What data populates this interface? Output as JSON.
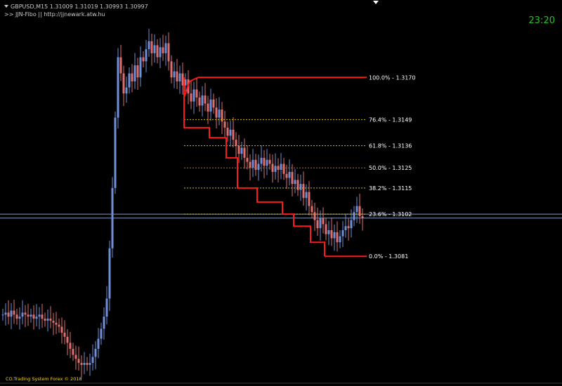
{
  "header": {
    "symbol_line": "GBPUSD,M15  1.31009 1.31019 1.30993 1.30997",
    "indicator_line": ">> JJN-Fibo || http://jjnewark.atw.hu"
  },
  "clock": "23:20",
  "copyright": "CO.Trading System Forex © 2018",
  "colors": {
    "background": "#000000",
    "bull_candle": "#6f8fd8",
    "bear_candle": "#e07070",
    "fib_frame": "#ff1a1a",
    "fib_level": "#d6c400",
    "fib_mid": "#c07000",
    "price_line": "#7d9cc4",
    "clock": "#21c321"
  },
  "chart_data": {
    "type": "candlestick",
    "symbol": "GBPUSD",
    "timeframe": "M15",
    "ylim": [
      1.302,
      1.3205
    ],
    "last_bar": {
      "open": 1.31009,
      "high": 1.31019,
      "low": 1.30993,
      "close": 1.30997
    },
    "closes": [
      1.3052,
      1.3053,
      1.3051,
      1.3054,
      1.3052,
      1.305,
      1.3051,
      1.3053,
      1.3052,
      1.3051,
      1.3052,
      1.305,
      1.3051,
      1.3052,
      1.305,
      1.3049,
      1.305,
      1.3049,
      1.3048,
      1.3047,
      1.3046,
      1.3043,
      1.3041,
      1.3038,
      1.3035,
      1.3032,
      1.303,
      1.3028,
      1.3027,
      1.3028,
      1.3027,
      1.3028,
      1.3031,
      1.3035,
      1.304,
      1.3045,
      1.3051,
      1.306,
      1.3085,
      1.3115,
      1.315,
      1.318,
      1.3172,
      1.3162,
      1.3165,
      1.3172,
      1.3168,
      1.3176,
      1.317,
      1.318,
      1.3178,
      1.3184,
      1.3188,
      1.3182,
      1.3186,
      1.318,
      1.3185,
      1.3182,
      1.3187,
      1.3178,
      1.317,
      1.3173,
      1.3168,
      1.3172,
      1.3166,
      1.3169,
      1.3162,
      1.3158,
      1.3164,
      1.316,
      1.3156,
      1.3161,
      1.3157,
      1.3153,
      1.3159,
      1.3155,
      1.315,
      1.3154,
      1.3148,
      1.3145,
      1.3141,
      1.3144,
      1.3139,
      1.3136,
      1.3132,
      1.3135,
      1.313,
      1.3128,
      1.3125,
      1.3129,
      1.3124,
      1.3127,
      1.313,
      1.3126,
      1.3129,
      1.3127,
      1.3123,
      1.3126,
      1.3124,
      1.3127,
      1.3122,
      1.312,
      1.3123,
      1.3117,
      1.3119,
      1.3114,
      1.3117,
      1.311,
      1.3113,
      1.3106,
      1.3103,
      1.3099,
      1.3095,
      1.31,
      1.3097,
      1.3092,
      1.3094,
      1.309,
      1.3093,
      1.3088,
      1.3091,
      1.3094,
      1.3096,
      1.3095,
      1.3099,
      1.3103,
      1.3106,
      1.3101,
      1.31
    ],
    "fib_levels": [
      {
        "label": "100.0% - 1.3170",
        "value": 1.317
      },
      {
        "label": "76.4% - 1.3149",
        "value": 1.3149
      },
      {
        "label": "61.8% - 1.3136",
        "value": 1.3136
      },
      {
        "label": "50.0% - 1.3125",
        "value": 1.3125
      },
      {
        "label": "38.2% - 1.3115",
        "value": 1.3115
      },
      {
        "label": "23.6% - 1.3102",
        "value": 1.3102
      },
      {
        "label": "0.0% - 1.3081",
        "value": 1.3081
      }
    ],
    "price_lines": [
      1.3102,
      1.31
    ]
  }
}
